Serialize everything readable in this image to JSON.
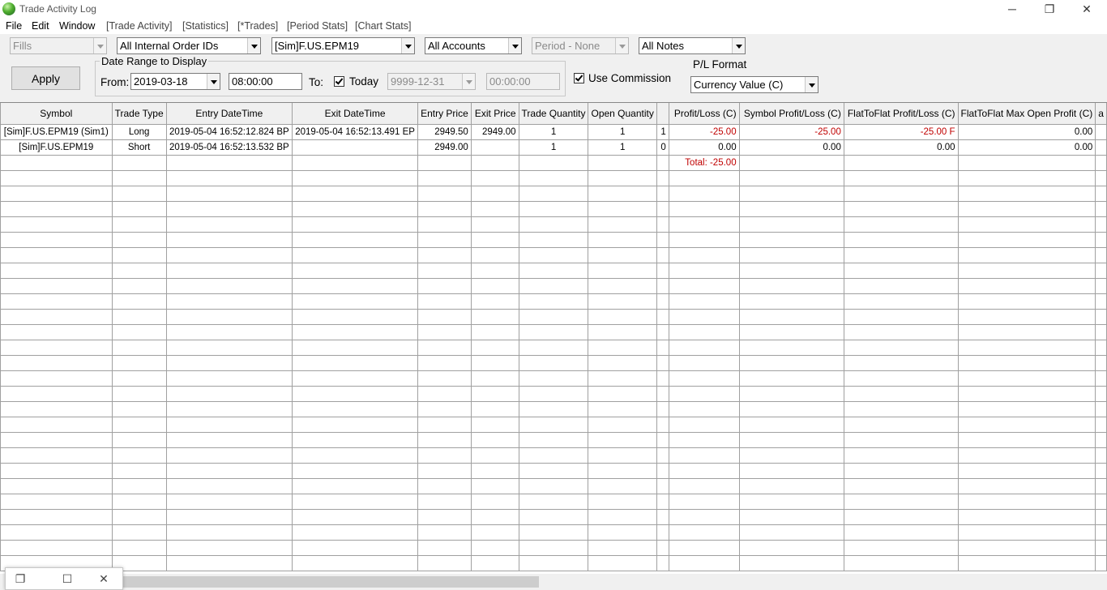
{
  "window": {
    "title": "Trade Activity Log",
    "controls": {
      "minimize": "─",
      "restore": "❐",
      "close": "✕"
    }
  },
  "menu": {
    "file": "File",
    "edit": "Edit",
    "window": "Window",
    "trade_activity": "[Trade Activity]",
    "statistics": "[Statistics]",
    "trades": "[*Trades]",
    "period_stats": "[Period Stats]",
    "chart_stats": "[Chart Stats]"
  },
  "filters": {
    "fills": "Fills",
    "order_ids": "All Internal Order IDs",
    "symbol": "[Sim]F.US.EPM19",
    "accounts": "All Accounts",
    "period": "Period - None",
    "notes": "All Notes"
  },
  "apply_label": "Apply",
  "date_range": {
    "legend": "Date Range to Display",
    "from_label": "From:",
    "from_date": "2019-03-18",
    "from_time": "08:00:00",
    "to_label": "To:",
    "today_label": "Today",
    "today_checked": true,
    "to_date": "9999-12-31",
    "to_time": "00:00:00"
  },
  "use_commission": {
    "label": "Use Commission",
    "checked": true
  },
  "pl_format": {
    "label": "P/L Format",
    "value": "Currency Value (C)"
  },
  "table": {
    "headers": [
      "Symbol",
      "Trade Type",
      "Entry DateTime",
      "Exit DateTime",
      "Entry Price",
      "Exit Price",
      "Trade Quantity",
      "Open Quantity",
      "",
      "Profit/Loss (C)",
      "Symbol Profit/Loss (C)",
      "FlatToFlat Profit/Loss (C)",
      "FlatToFlat Max Open Profit (C)",
      "a"
    ],
    "rows": [
      [
        "[Sim]F.US.EPM19 (Sim1)",
        "Long",
        "2019-05-04  16:52:12.824 BP",
        "2019-05-04  16:52:13.491 EP",
        "2949.50",
        "2949.00",
        "1",
        "1",
        "1",
        "-25.00",
        "-25.00",
        "-25.00 F",
        "0.00",
        ""
      ],
      [
        "[Sim]F.US.EPM19",
        "Short",
        "2019-05-04  16:52:13.532 BP",
        "",
        "2949.00",
        "",
        "1",
        "1",
        "0",
        "0.00",
        "0.00",
        "0.00",
        "0.00",
        ""
      ],
      [
        "",
        "",
        "",
        "",
        "",
        "",
        "",
        "",
        "",
        "Total: -25.00",
        "",
        "",
        "",
        ""
      ]
    ],
    "negative_color": "#c00000"
  },
  "mini_window": {
    "restore": "❐",
    "maximize": "☐",
    "close": "✕"
  }
}
